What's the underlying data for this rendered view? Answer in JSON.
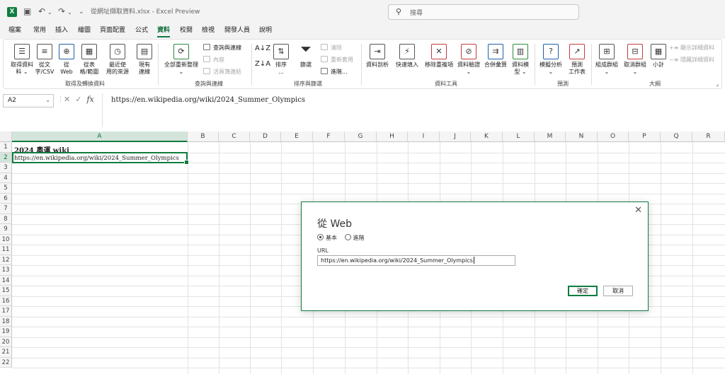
{
  "title_bar": {
    "document_title": "從網址擷取資料.xlsx  -  Excel Preview",
    "search_placeholder": "搜尋"
  },
  "menu": {
    "tabs": [
      "檔案",
      "常用",
      "插入",
      "繪圖",
      "頁面配置",
      "公式",
      "資料",
      "校閱",
      "檢視",
      "開發人員",
      "說明"
    ],
    "active_tab": "資料"
  },
  "ribbon": {
    "get_transform": {
      "label": "取得及轉換資料",
      "buttons": [
        "取得資料",
        "料 ⌄",
        "從文",
        "字/CSV",
        "從",
        "Web",
        "從表",
        "格/範圍",
        "最近使",
        "用的來源",
        "現有",
        "連線"
      ]
    },
    "queries": {
      "label": "查詢與連線",
      "refresh_all": [
        "全部重新整理",
        "⌄"
      ],
      "queries_connections": "查詢與連線",
      "properties": "內容",
      "edit_links": "活頁簿連結"
    },
    "sort_filter": {
      "label": "排序與篩選",
      "sort": "排序",
      "sort_dots": "...",
      "filter": "篩選",
      "clear": "清除",
      "reapply": "重新套用",
      "advanced": "進階..."
    },
    "data_tools": {
      "label": "資料工具",
      "text_to_columns": "資料剖析",
      "flash_fill": "快速填入",
      "remove_duplicates": "移除重複項",
      "data_validation": "資料驗證",
      "data_validation_sub": "⌄",
      "consolidate": "合併彙算",
      "data_model": "資料模",
      "data_model_sub": "型 ⌄"
    },
    "forecast": {
      "label": "預測",
      "what_if": "模擬分析",
      "what_if_sub": "⌄",
      "forecast_sheet": "預測",
      "forecast_sheet_sub": "工作表"
    },
    "outline": {
      "label": "大綱",
      "group": "組成群組",
      "group_sub": "⌄",
      "ungroup": "取消群組",
      "ungroup_sub": "⌄",
      "subtotal": "小計",
      "show_detail": "顯示詳細資料",
      "hide_detail": "隱藏詳細資料"
    }
  },
  "formula_bar": {
    "name_box": "A2",
    "content": "https://en.wikipedia.org/wiki/2024_Summer_Olympics"
  },
  "sheet": {
    "columns": [
      "A",
      "B",
      "C",
      "D",
      "E",
      "F",
      "G",
      "H",
      "I",
      "J",
      "K",
      "L",
      "M",
      "N",
      "O",
      "P",
      "Q",
      "R"
    ],
    "rows": [
      "1",
      "2",
      "3",
      "4",
      "5",
      "6",
      "7",
      "8",
      "9",
      "10",
      "11",
      "12",
      "13",
      "14",
      "15",
      "16",
      "17",
      "18",
      "19",
      "20",
      "21",
      "22"
    ],
    "a1": "2024 奧運 wiki",
    "a2": "https://en.wikipedia.org/wiki/2024_Summer_Olympics"
  },
  "dialog": {
    "title": "從 Web",
    "radio_basic": "基本",
    "radio_advanced": "進階",
    "url_label": "URL",
    "url_value": "https://en.wikipedia.org/wiki/2024_Summer_Olympics",
    "ok": "確定",
    "cancel": "取消"
  }
}
